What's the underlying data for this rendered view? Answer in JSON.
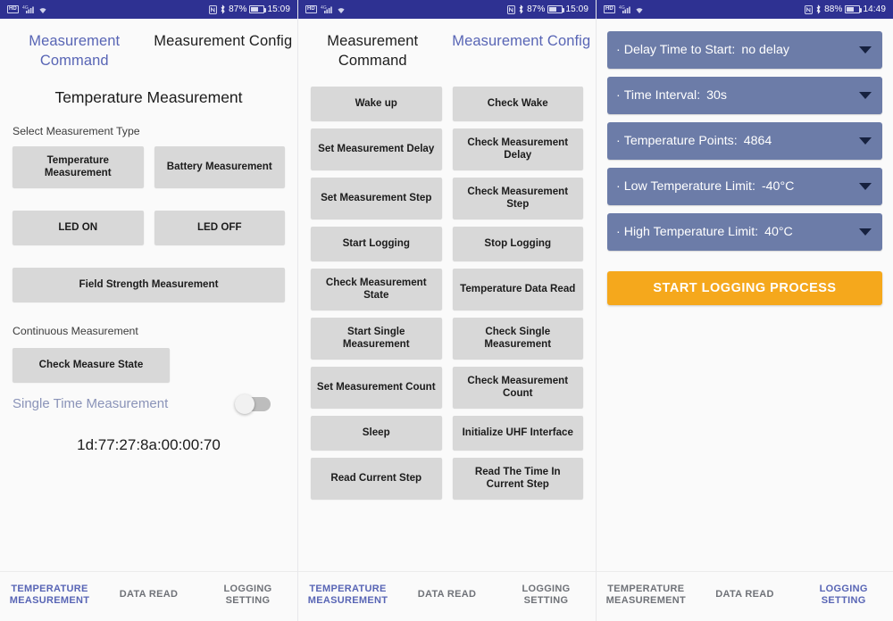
{
  "status_bars": [
    {
      "icons": [
        "hd-icon",
        "signal-icon",
        "wifi-icon"
      ],
      "nfc": "nfc-icon",
      "bluetooth": "bluetooth-icon",
      "battery_pct": "87%",
      "time": "15:09"
    },
    {
      "icons": [
        "hd-icon",
        "signal-icon",
        "wifi-icon"
      ],
      "nfc": "nfc-icon",
      "bluetooth": "bluetooth-icon",
      "battery_pct": "87%",
      "time": "15:09"
    },
    {
      "icons": [
        "hd-icon",
        "signal-icon",
        "wifi-icon"
      ],
      "nfc": "nfc-icon",
      "bluetooth": "bluetooth-icon",
      "battery_pct": "88%",
      "time": "14:49"
    }
  ],
  "colors": {
    "status_bar": "#2e3192",
    "accent_blue": "#5865b5",
    "button_grey": "#d8d8d8",
    "dropdown_blue": "#6c7ca8",
    "start_button_orange": "#f5a81c",
    "page_bg": "#fafafa"
  },
  "screen1": {
    "tabs": [
      {
        "label": "Measurement Command",
        "active": true
      },
      {
        "label": "Measurement Config",
        "active": false
      }
    ],
    "section_title": "Temperature Measurement",
    "select_type_label": "Select Measurement Type",
    "buttons": {
      "temperature_measurement": "Temperature Measurement",
      "battery_measurement": "Battery Measurement",
      "led_on": "LED ON",
      "led_off": "LED OFF",
      "field_strength": "Field Strength Measurement",
      "check_measure_state": "Check Measure State"
    },
    "continuous_label": "Continuous Measurement",
    "single_time_label": "Single Time Measurement",
    "single_time_toggle": "off",
    "tag_id": "1d:77:27:8a:00:00:70",
    "bottom_nav": [
      {
        "label": "TEMPERATURE MEASUREMENT",
        "active": true
      },
      {
        "label": "DATA READ",
        "active": false
      },
      {
        "label": "LOGGING SETTING",
        "active": false
      }
    ]
  },
  "screen2": {
    "tabs": [
      {
        "label": "Measurement Command",
        "active": false
      },
      {
        "label": "Measurement Config",
        "active": true
      }
    ],
    "commands": [
      "Wake up",
      "Check Wake",
      "Set Measurement Delay",
      "Check Measurement Delay",
      "Set Measurement Step",
      "Check Measurement Step",
      "Start Logging",
      "Stop Logging",
      "Check Measurement State",
      "Temperature Data Read",
      "Start Single Measurement",
      "Check Single Measurement",
      "Set Measurement Count",
      "Check Measurement Count",
      "Sleep",
      "Initialize UHF Interface",
      "Read Current Step",
      "Read The Time In Current Step"
    ],
    "bottom_nav": [
      {
        "label": "TEMPERATURE MEASUREMENT",
        "active": true
      },
      {
        "label": "DATA READ",
        "active": false
      },
      {
        "label": "LOGGING SETTING",
        "active": false
      }
    ]
  },
  "screen3": {
    "settings": [
      {
        "label": "Delay Time to Start:",
        "value": "no delay"
      },
      {
        "label": "Time Interval:",
        "value": "30s"
      },
      {
        "label": "Temperature Points:",
        "value": "4864"
      },
      {
        "label": "Low Temperature Limit:",
        "value": "-40°C"
      },
      {
        "label": "High Temperature Limit:",
        "value": "40°C"
      }
    ],
    "start_button": "START LOGGING PROCESS",
    "bottom_nav": [
      {
        "label": "TEMPERATURE MEASUREMENT",
        "active": false
      },
      {
        "label": "DATA READ",
        "active": false
      },
      {
        "label": "LOGGING SETTING",
        "active": true
      }
    ]
  }
}
